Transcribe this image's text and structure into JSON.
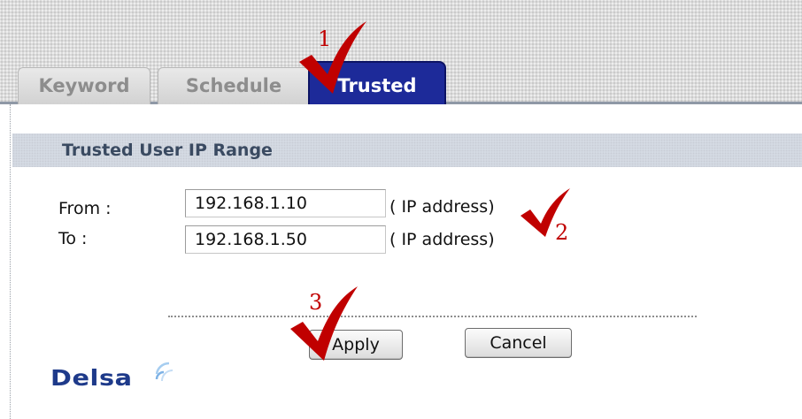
{
  "tabs": [
    {
      "label": "Keyword",
      "active": false
    },
    {
      "label": "Schedule",
      "active": false
    },
    {
      "label": "Trusted",
      "active": true
    }
  ],
  "section": {
    "title": "Trusted User IP Range"
  },
  "form": {
    "from": {
      "label": "From :",
      "value": "192.168.1.10",
      "hint": "( IP address)"
    },
    "to": {
      "label": "To :",
      "value": "192.168.1.50",
      "hint": "( IP address)"
    }
  },
  "buttons": {
    "apply": "Apply",
    "cancel": "Cancel"
  },
  "logo": {
    "text": "Delsa"
  },
  "annotations": [
    "1",
    "2",
    "3"
  ],
  "colors": {
    "active_tab": "#1d2a99",
    "annotation_red": "#c00000",
    "section_title": "#3a4a61",
    "logo": "#1e3a8a"
  }
}
